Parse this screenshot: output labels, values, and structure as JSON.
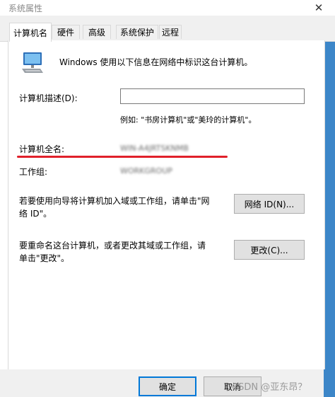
{
  "window": {
    "title": "系统属性",
    "close_icon": "close-icon"
  },
  "tabs": [
    {
      "label": "计算机名",
      "active": true
    },
    {
      "label": "硬件",
      "active": false
    },
    {
      "label": "高级",
      "active": false
    },
    {
      "label": "系统保护",
      "active": false
    },
    {
      "label": "远程",
      "active": false
    }
  ],
  "panel": {
    "intro": "Windows 使用以下信息在网络中标识这台计算机。",
    "description_label": "计算机描述(D):",
    "description_value": "",
    "example": "例如: \"书房计算机\"或\"美玲的计算机\"。",
    "fullname_label": "计算机全名:",
    "fullname_value": "WIN-A4JRTSKNMB",
    "workgroup_label": "工作组:",
    "workgroup_value": "WORKGROUP",
    "network_text": "若要使用向导将计算机加入域或工作组，请单击\"网络 ID\"。",
    "network_button": "网络 ID(N)...",
    "rename_text": "要重命名这台计算机，或者更改其域或工作组，请单击\"更改\"。",
    "change_button": "更改(C)..."
  },
  "footer": {
    "ok_button": "确定",
    "cancel_button": "取消",
    "watermark": "CSDN @亚东昂？"
  },
  "colors": {
    "highlight_line": "#e0202a",
    "focus": "#0078d7",
    "side_strip": "#3c86c8"
  }
}
